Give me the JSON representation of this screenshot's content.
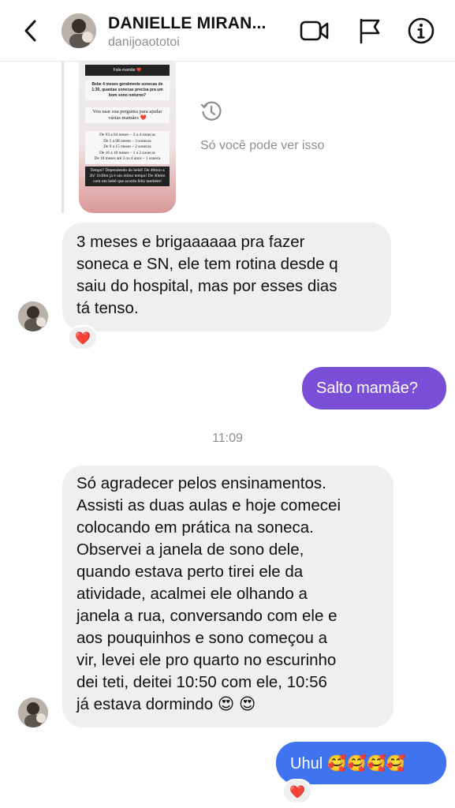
{
  "header": {
    "name": "DANIELLE MIRAN...",
    "username": "danijoaototoi",
    "icons": [
      "back-chevron-icon",
      "video-camera-icon",
      "flag-icon",
      "info-icon"
    ]
  },
  "story": {
    "title": "Fala mamãe ❤️",
    "question": "Bebe 4 meses geralmente sonecas de 1:30, quantas sonecas precisa pra um bom sono noturno?",
    "intro": "Vou usar sua pergunta para ajudar várias mamães ❤️",
    "schedule": [
      "De 03 a 04 meses – 3 a 4 sonecas",
      "De 5 a 08 meses – 3 sonecas",
      "De 9 a 15 meses – 2 sonecas",
      "De 16 a 18 meses – 1 a 2 sonecas",
      "De 18 meses até 3 ou 4 anos – 1 soneca"
    ],
    "answer": "Tempo? Dependendo do bebê! De 40min a 2h! 1h30m já é um ótimo tempo! De 40min com um bebê que acorda feliz também!",
    "seen_label": "Só você pode ver isso"
  },
  "messages": {
    "m1": {
      "lines": [
        "3 meses e brigaaaaaa pra fazer",
        "soneca e SN, ele tem rotina desde q",
        "saiu do hospital, mas por esses dias",
        "tá tenso."
      ],
      "reaction": "❤️"
    },
    "m2": {
      "text": "Salto mamãe?"
    },
    "timestamp": "11:09",
    "m3": {
      "lines": [
        "Só agradecer pelos ensinamentos.",
        "Assisti as duas aulas e hoje comecei",
        "colocando em prática na soneca.",
        "Observei a janela de sono dele,",
        "quando estava perto tirei ele da",
        "atividade, acalmei ele olhando a",
        "janela a rua, conversando com ele e",
        "aos pouquinhos e sono começou a",
        "vir, levei ele pro quarto no escurinho",
        "dei teti, deitei 10:50 com ele, 10:56",
        "já estava dormindo 😍 😍"
      ]
    },
    "m4": {
      "text": "Uhul 🥰🥰🥰🥰",
      "reaction": "❤️"
    }
  },
  "colors": {
    "outgoing_purple": "#7a4fd8",
    "outgoing_blue": "#3f73f0",
    "incoming_bg": "#efefef",
    "muted_text": "#8e8e8e"
  }
}
